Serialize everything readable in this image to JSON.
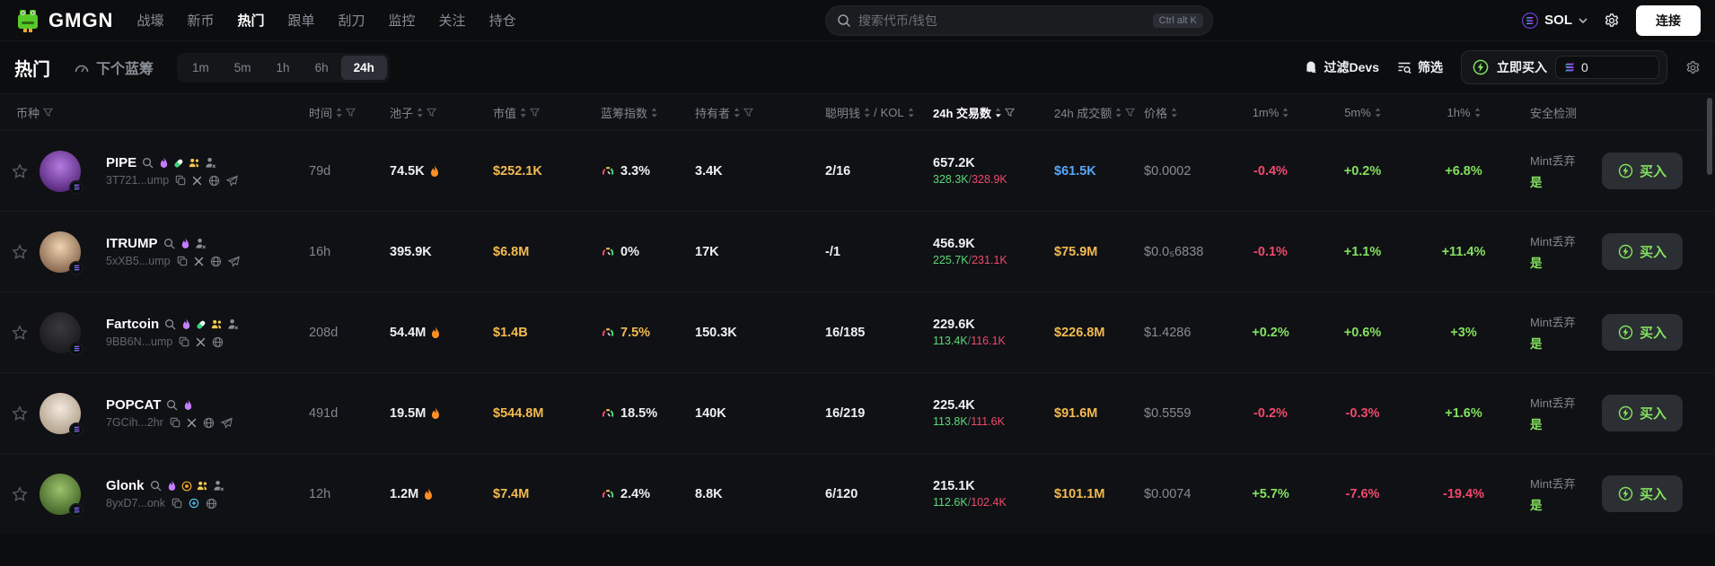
{
  "topbar": {
    "logo_text": "GMGN",
    "nav": [
      {
        "label": "战壕",
        "active": false
      },
      {
        "label": "新币",
        "active": false
      },
      {
        "label": "热门",
        "active": true
      },
      {
        "label": "跟单",
        "active": false
      },
      {
        "label": "刮刀",
        "active": false
      },
      {
        "label": "监控",
        "active": false
      },
      {
        "label": "关注",
        "active": false
      },
      {
        "label": "持仓",
        "active": false
      }
    ],
    "search": {
      "placeholder": "搜索代币/钱包",
      "shortcut": "Ctrl alt K"
    },
    "chain": "SOL",
    "connect_label": "连接"
  },
  "subheader": {
    "title": "热门",
    "next_bluechip": "下个蓝筹",
    "time_filters": [
      "1m",
      "5m",
      "1h",
      "6h",
      "24h"
    ],
    "active_time_index": 4,
    "filter_devs": "过滤Devs",
    "filter_label": "筛选",
    "instant_buy": {
      "label": "立即买入",
      "amount": "0"
    }
  },
  "table": {
    "headers": {
      "coin": "币种",
      "age": "时间",
      "pool": "池子",
      "mcap": "市值",
      "bluechip": "蓝筹指数",
      "holders": "持有者",
      "smart": "聪明钱",
      "smart_sep": "/",
      "kol": "KOL",
      "tx": "24h 交易数",
      "vol": "24h 成交额",
      "price": "价格",
      "m1": "1m%",
      "m5": "5m%",
      "h1": "1h%",
      "security": "安全检测"
    },
    "security_label": "Mint丢弃",
    "buy_label": "买入",
    "slash": "/",
    "rows": [
      {
        "name": "PIPE",
        "address": "3T721...ump",
        "age": "79d",
        "pool": "74.5K",
        "pool_hot": true,
        "mcap": "$252.1K",
        "bluechip": "3.3%",
        "bluechip_color": "white",
        "holders": "3.4K",
        "smart_kol": "2/16",
        "tx": "657.2K",
        "tx_buys": "328.3K",
        "tx_sells": "328.9K",
        "volume": "$61.5K",
        "volume_color": "blue",
        "price": "$0.0002",
        "m1": "-0.4%",
        "m5": "+0.2%",
        "h1": "+6.8%",
        "security": "是",
        "title_icons": [
          "flame",
          "pill",
          "people",
          "person-x"
        ],
        "link_icons": [
          "copy",
          "x",
          "globe",
          "telegram"
        ],
        "avatar": {
          "from": "#b57ae0",
          "to": "#5a2b80"
        }
      },
      {
        "name": "ITRUMP",
        "address": "5xXB5...ump",
        "age": "16h",
        "pool": "395.9K",
        "pool_hot": false,
        "mcap": "$6.8M",
        "bluechip": "0%",
        "bluechip_color": "white",
        "holders": "17K",
        "smart_kol": "-/1",
        "tx": "456.9K",
        "tx_buys": "225.7K",
        "tx_sells": "231.1K",
        "volume": "$75.9M",
        "volume_color": "orange",
        "price": "$0.0₅6838",
        "m1": "-0.1%",
        "m5": "+1.1%",
        "h1": "+11.4%",
        "security": "是",
        "title_icons": [
          "flame",
          "person-x"
        ],
        "link_icons": [
          "copy",
          "x",
          "globe",
          "telegram"
        ],
        "avatar": {
          "from": "#f0d4b0",
          "to": "#8a6a52"
        }
      },
      {
        "name": "Fartcoin",
        "address": "9BB6N...ump",
        "age": "208d",
        "pool": "54.4M",
        "pool_hot": true,
        "mcap": "$1.4B",
        "bluechip": "7.5%",
        "bluechip_color": "yellow",
        "holders": "150.3K",
        "smart_kol": "16/185",
        "tx": "229.6K",
        "tx_buys": "113.4K",
        "tx_sells": "116.1K",
        "volume": "$226.8M",
        "volume_color": "orange",
        "price": "$1.4286",
        "m1": "+0.2%",
        "m5": "+0.6%",
        "h1": "+3%",
        "security": "是",
        "title_icons": [
          "flame",
          "pill",
          "people",
          "person-x"
        ],
        "link_icons": [
          "copy",
          "x",
          "globe"
        ],
        "avatar": {
          "from": "#3a3a3e",
          "to": "#1c1c1f"
        }
      },
      {
        "name": "POPCAT",
        "address": "7GCih...2hr",
        "age": "491d",
        "pool": "19.5M",
        "pool_hot": true,
        "mcap": "$544.8M",
        "bluechip": "18.5%",
        "bluechip_color": "white",
        "holders": "140K",
        "smart_kol": "16/219",
        "tx": "225.4K",
        "tx_buys": "113.8K",
        "tx_sells": "111.6K",
        "volume": "$91.6M",
        "volume_color": "orange",
        "price": "$0.5559",
        "m1": "-0.2%",
        "m5": "-0.3%",
        "h1": "+1.6%",
        "security": "是",
        "title_icons": [
          "flame"
        ],
        "link_icons": [
          "copy",
          "x",
          "globe",
          "telegram"
        ],
        "avatar": {
          "from": "#f2e9dd",
          "to": "#b4a38f"
        }
      },
      {
        "name": "Glonk",
        "address": "8yxD7...onk",
        "age": "12h",
        "pool": "1.2M",
        "pool_hot": true,
        "mcap": "$7.4M",
        "bluechip": "2.4%",
        "bluechip_color": "white",
        "holders": "8.8K",
        "smart_kol": "6/120",
        "tx": "215.1K",
        "tx_buys": "112.6K",
        "tx_sells": "102.4K",
        "volume": "$101.1M",
        "volume_color": "orange",
        "price": "$0.0074",
        "m1": "+5.7%",
        "m5": "-7.6%",
        "h1": "-19.4%",
        "security": "是",
        "title_icons": [
          "flame",
          "badge",
          "people",
          "person-x"
        ],
        "link_icons": [
          "copy",
          "link",
          "globe"
        ],
        "avatar": {
          "from": "#9bc26b",
          "to": "#47682c"
        }
      }
    ]
  },
  "colors": {
    "green": "#83e15f",
    "red": "#f0486c",
    "orange": "#f3bb4f",
    "blue": "#58a6f7",
    "accent_purple": "#c77dff"
  }
}
